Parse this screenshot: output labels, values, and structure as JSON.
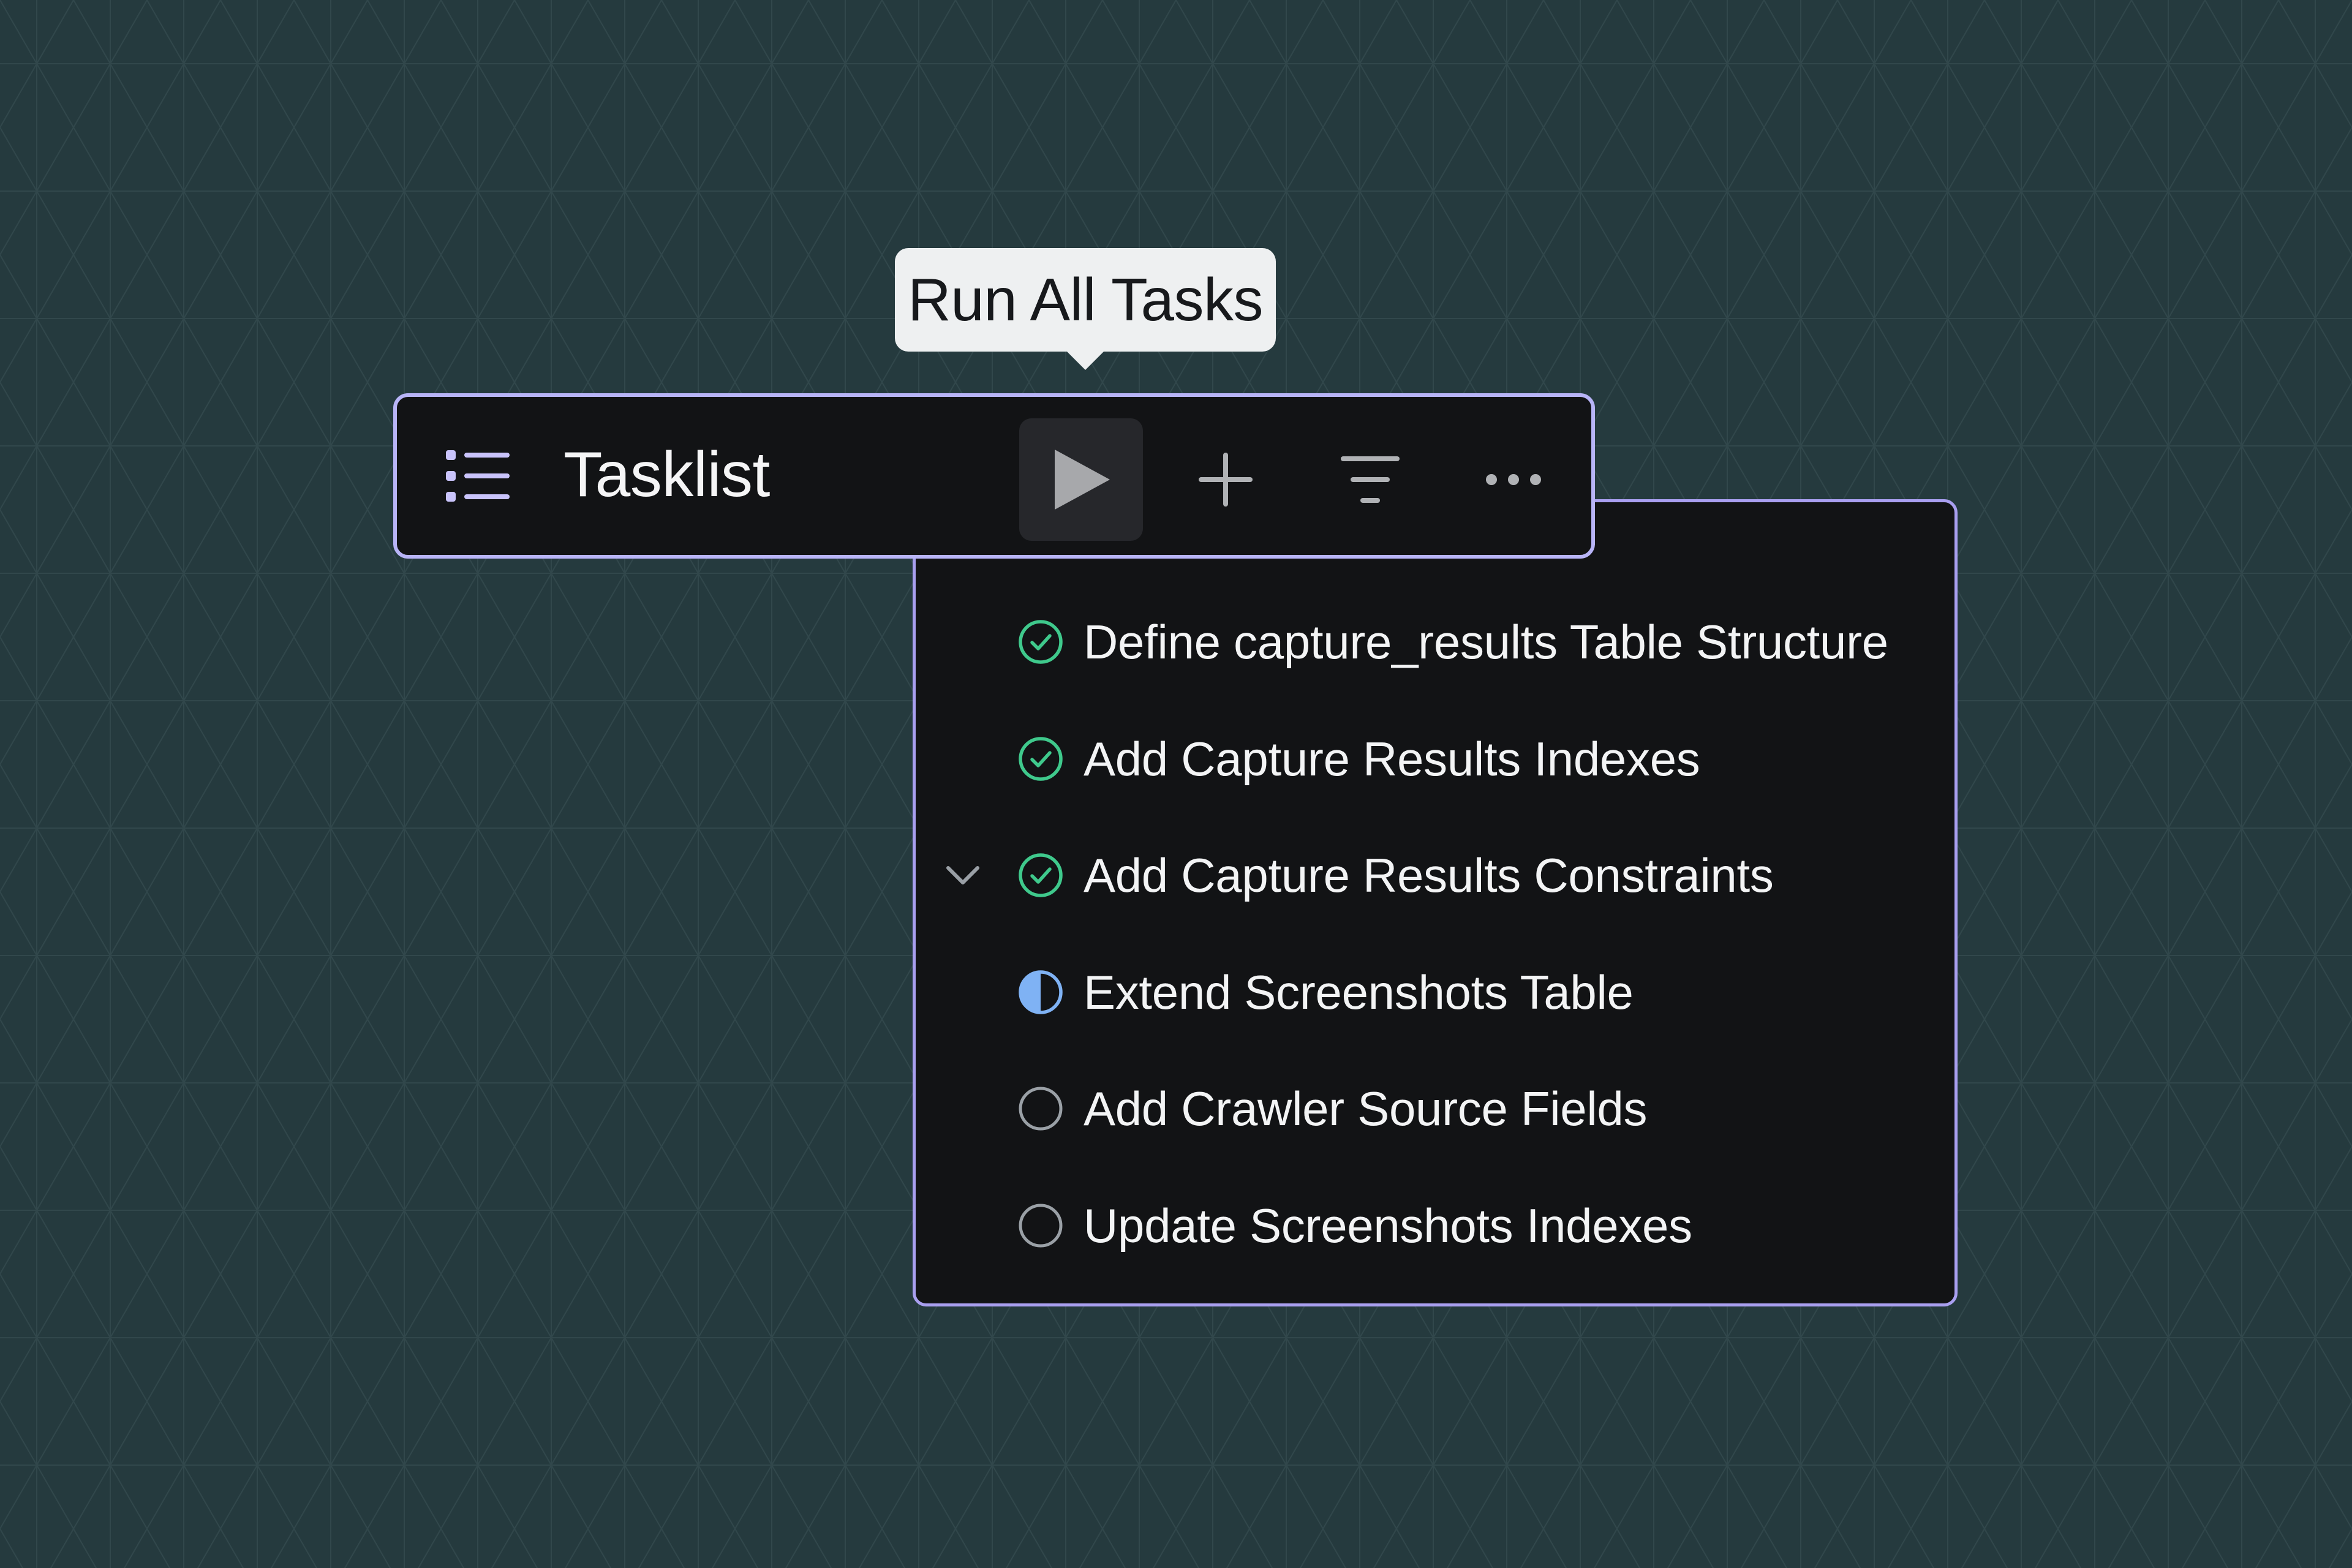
{
  "tooltip": {
    "text": "Run All Tasks"
  },
  "toolbar": {
    "title": "Tasklist",
    "icons": {
      "list": "list-icon",
      "run": "play-icon",
      "add": "plus-icon",
      "filter": "filter-icon",
      "more": "more-horizontal-icon"
    }
  },
  "colors": {
    "background": "#253a3e",
    "panel": "#121315",
    "accent_border": "#a99ff0",
    "done": "#3fc98c",
    "in_progress": "#7fb2f4",
    "pending": "#9aa0a6"
  },
  "tasks": [
    {
      "label": "Define capture_results Table Structure",
      "status": "done",
      "expanded": false
    },
    {
      "label": "Add Capture Results Indexes",
      "status": "done",
      "expanded": false
    },
    {
      "label": "Add Capture Results Constraints",
      "status": "done",
      "expanded": true
    },
    {
      "label": "Extend Screenshots Table",
      "status": "in-progress",
      "expanded": false
    },
    {
      "label": "Add Crawler Source Fields",
      "status": "pending",
      "expanded": false
    },
    {
      "label": "Update Screenshots Indexes",
      "status": "pending",
      "expanded": false
    }
  ]
}
